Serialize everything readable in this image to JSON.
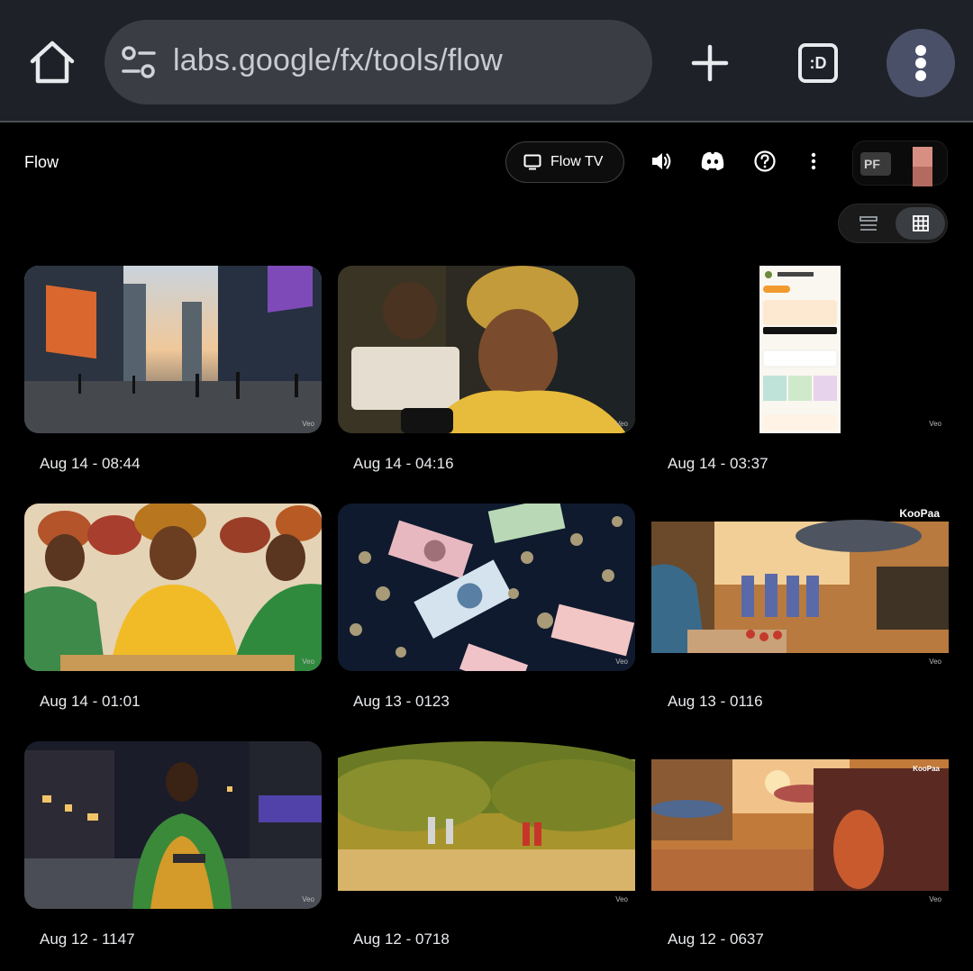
{
  "browser": {
    "url": "labs.google/fx/tools/flow",
    "tabs_label": ":D",
    "icons": [
      "home-icon",
      "tune-icon",
      "plus-icon",
      "tab-switcher-icon",
      "more-vertical-icon"
    ]
  },
  "app": {
    "title": "Flow",
    "flow_tv_label": "Flow TV",
    "avatar_initials": "PF",
    "view_modes": [
      "list",
      "grid"
    ],
    "active_view": "grid"
  },
  "cards": [
    {
      "caption": "Aug 14 - 08:44",
      "thumb": "city-billboards"
    },
    {
      "caption": "Aug 14 - 04:16",
      "thumb": "elder-woman-phone"
    },
    {
      "caption": "Aug 14 - 03:37",
      "thumb": "app-screenshot"
    },
    {
      "caption": "Aug 14 - 01:01",
      "thumb": "women-counting-money"
    },
    {
      "caption": "Aug 13 - 0123",
      "thumb": "falling-banknotes"
    },
    {
      "caption": "Aug 13 - 0116",
      "thumb": "market-sunset",
      "watermark": "KooPaa"
    },
    {
      "caption": "Aug 12 - 1147",
      "thumb": "man-tablet-night-street"
    },
    {
      "caption": "Aug 12 - 0718",
      "thumb": "village-trees"
    },
    {
      "caption": "Aug 12 - 0637",
      "thumb": "market-street-sunset",
      "watermark": "KooPaa"
    }
  ],
  "thumb_badge": "Veo",
  "colors": {
    "chrome_bg": "#1e2127",
    "url_pill": "#3a3d44",
    "menu_circle": "#4a5068",
    "page_bg": "#000000"
  }
}
